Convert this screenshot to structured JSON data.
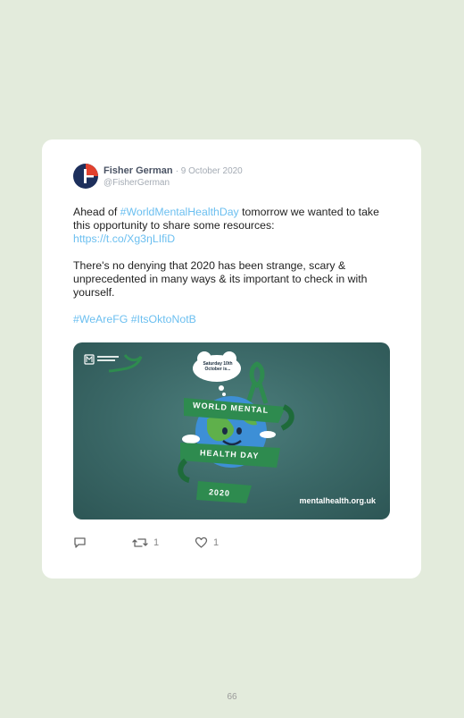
{
  "tweet": {
    "author_name": "Fisher German",
    "date": "· 9 October 2020",
    "handle": "@FisherGerman",
    "line1_prefix": "Ahead of ",
    "hashtag_wmhd": "#WorldMentalHealthDay",
    "line1_suffix": " tomorrow we wanted to take this opportunity to share some resources:",
    "short_link": "https://t.co/Xg3ŋLIfiD",
    "paragraph2": "There's no denying that 2020 has been strange, scary & unprecedented in many ways & its important to check in with yourself.",
    "hashtag_fg": "#WeAreFG",
    "hashtag_ok": "#ItsOktoNotB"
  },
  "media": {
    "thought_bubble": "Saturday 10th October is...",
    "banner_top": "WORLD MENTAL",
    "banner_middle": "HEALTH DAY",
    "banner_bottom": "2020",
    "site_url": "mentalhealth.org.uk",
    "colors": {
      "background": "#3a6766",
      "ribbon": "#2e8b4f",
      "ribbon_dark": "#1e6b3a"
    }
  },
  "actions": {
    "reply_icon": "reply-icon",
    "retweet_icon": "retweet-icon",
    "retweet_count": "1",
    "like_icon": "heart-icon",
    "like_count": "1"
  },
  "page_number": "66"
}
